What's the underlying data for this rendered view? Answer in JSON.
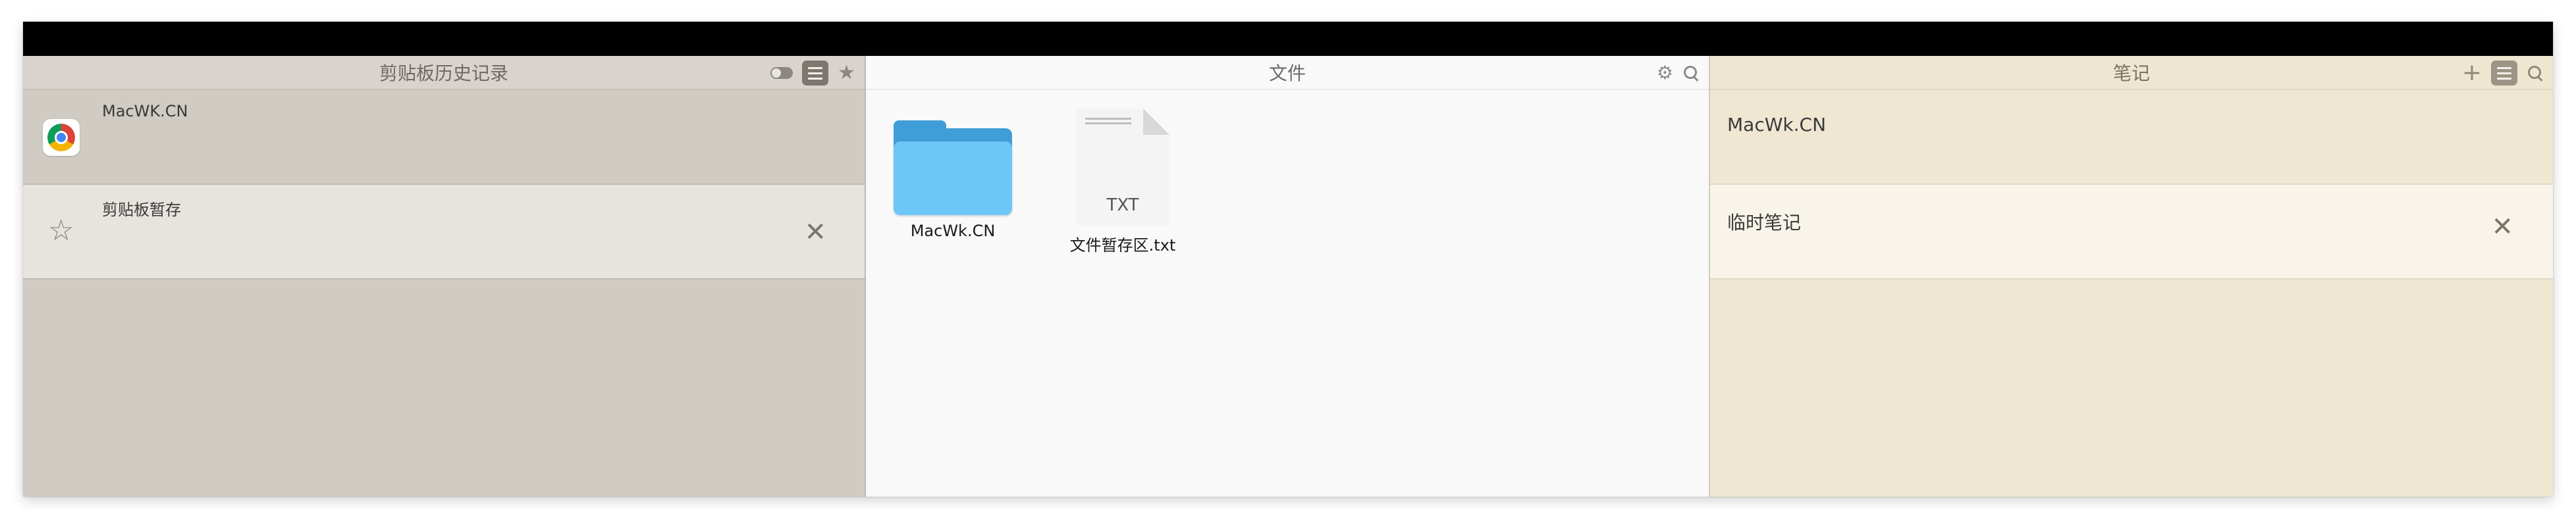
{
  "clipboard_pane": {
    "title": "剪贴板历史记录",
    "items": [
      {
        "text": "MacWK.CN",
        "icon": "chrome-icon"
      },
      {
        "text": "剪贴板暂存",
        "icon": "star-outline-icon"
      }
    ]
  },
  "files_pane": {
    "title": "文件",
    "items": [
      {
        "name": "MacWk.CN",
        "icon": "folder-icon"
      },
      {
        "name": "文件暂存区.txt",
        "icon": "txt-file-icon",
        "badge": "TXT"
      }
    ]
  },
  "notes_pane": {
    "title": "笔记",
    "items": [
      {
        "text": "MacWk.CN"
      },
      {
        "text": "临时笔记"
      }
    ]
  },
  "glyphs": {
    "star_solid": "★",
    "star_outline": "☆",
    "close": "✕",
    "gear": "⚙",
    "plus": "+"
  },
  "colors": {
    "clipboard_bg": "#d0cbc3",
    "files_bg": "#f9f9f9",
    "notes_bg": "#f0e7d3"
  }
}
